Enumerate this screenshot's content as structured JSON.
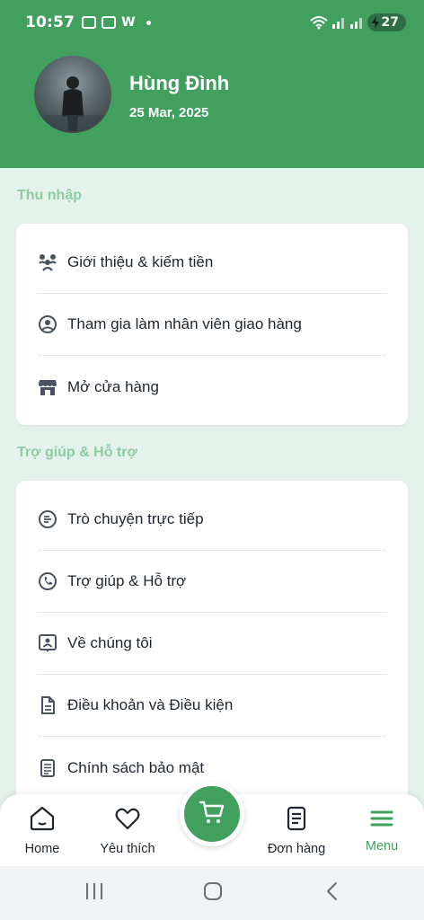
{
  "status_bar": {
    "time": "10:57",
    "app_letter": "W",
    "battery": "27"
  },
  "profile": {
    "name": "Hùng Đình",
    "date": "25 Mar, 2025"
  },
  "sections": [
    {
      "title": "Thu nhập",
      "items": [
        {
          "label": "Giới thiệu & kiếm tiền",
          "icon": "people-icon"
        },
        {
          "label": "Tham gia làm nhân viên giao hàng",
          "icon": "user-circle-icon"
        },
        {
          "label": "Mở cửa hàng",
          "icon": "store-icon"
        }
      ]
    },
    {
      "title": "Trợ giúp & Hỗ trợ",
      "items": [
        {
          "label": "Trò chuyện trực tiếp",
          "icon": "chat-icon"
        },
        {
          "label": "Trợ giúp & Hỗ trợ",
          "icon": "phone-icon"
        },
        {
          "label": "Về chúng tôi",
          "icon": "about-icon"
        },
        {
          "label": "Điều khoản và Điều kiện",
          "icon": "document-icon"
        },
        {
          "label": "Chính sách bảo mật",
          "icon": "policy-icon"
        }
      ]
    }
  ],
  "bottom_nav": {
    "home": "Home",
    "favorites": "Yêu thích",
    "orders": "Đơn hàng",
    "menu": "Menu"
  },
  "colors": {
    "primary": "#41a05e",
    "background": "#e3f2ea",
    "section_title": "#8fcaa2"
  }
}
